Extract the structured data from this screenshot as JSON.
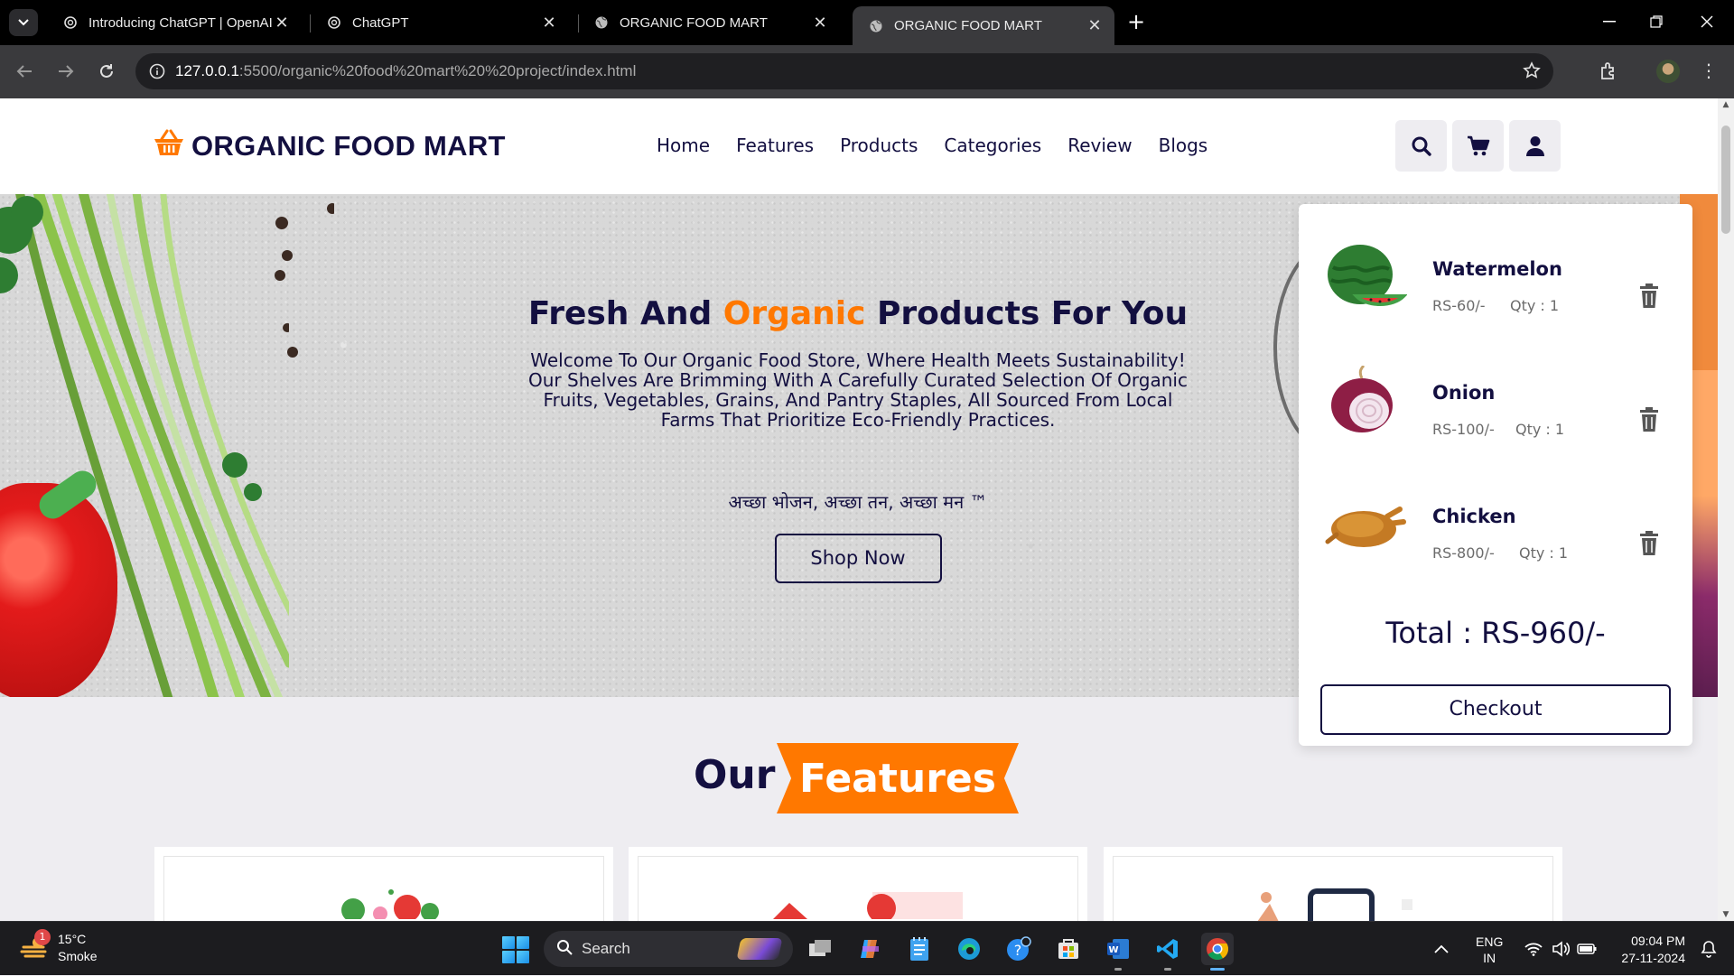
{
  "browser": {
    "tabs": [
      {
        "title": "Introducing ChatGPT | OpenAI",
        "icon": "openai-icon",
        "active": false
      },
      {
        "title": "ChatGPT",
        "icon": "openai-icon",
        "active": false
      },
      {
        "title": "ORGANIC FOOD MART",
        "icon": "globe-icon",
        "active": false
      },
      {
        "title": "ORGANIC FOOD MART",
        "icon": "globe-icon",
        "active": true
      }
    ],
    "url_host": "127.0.0.1",
    "url_path": ":5500/organic%20food%20mart%20%20project/index.html"
  },
  "site": {
    "logo": "ORGANIC FOOD MART",
    "nav": [
      "Home",
      "Features",
      "Products",
      "Categories",
      "Review",
      "Blogs"
    ],
    "accent_color": "#ff7800",
    "text_color": "#130f40"
  },
  "hero": {
    "title_pre": "Fresh And ",
    "title_accent": "Organic",
    "title_post": " Products For You",
    "description": "Welcome To Our Organic Food Store, Where Health Meets Sustainability! Our Shelves Are Brimming With A Carefully Curated Selection Of Organic Fruits, Vegetables, Grains, And Pantry Staples, All Sourced From Local Farms That Prioritize Eco-Friendly Practices.",
    "motto": "अच्छा भोजन, अच्छा तन, अच्छा मन ™",
    "cta": "Shop Now"
  },
  "features": {
    "heading_plain": "Our",
    "heading_highlight": "Features"
  },
  "cart": {
    "items": [
      {
        "name": "Watermelon",
        "price": "RS-60/-",
        "qty": "Qty : 1"
      },
      {
        "name": "Onion",
        "price": "RS-100/-",
        "qty": "Qty : 1"
      },
      {
        "name": "Chicken",
        "price": "RS-800/-",
        "qty": "Qty : 1"
      }
    ],
    "total": "Total : RS-960/-",
    "checkout": "Checkout"
  },
  "taskbar": {
    "weather_temp": "15°C",
    "weather_desc": "Smoke",
    "weather_badge": "1",
    "search_placeholder": "Search",
    "lang_top": "ENG",
    "lang_bottom": "IN",
    "time": "09:04 PM",
    "date": "27-11-2024"
  }
}
